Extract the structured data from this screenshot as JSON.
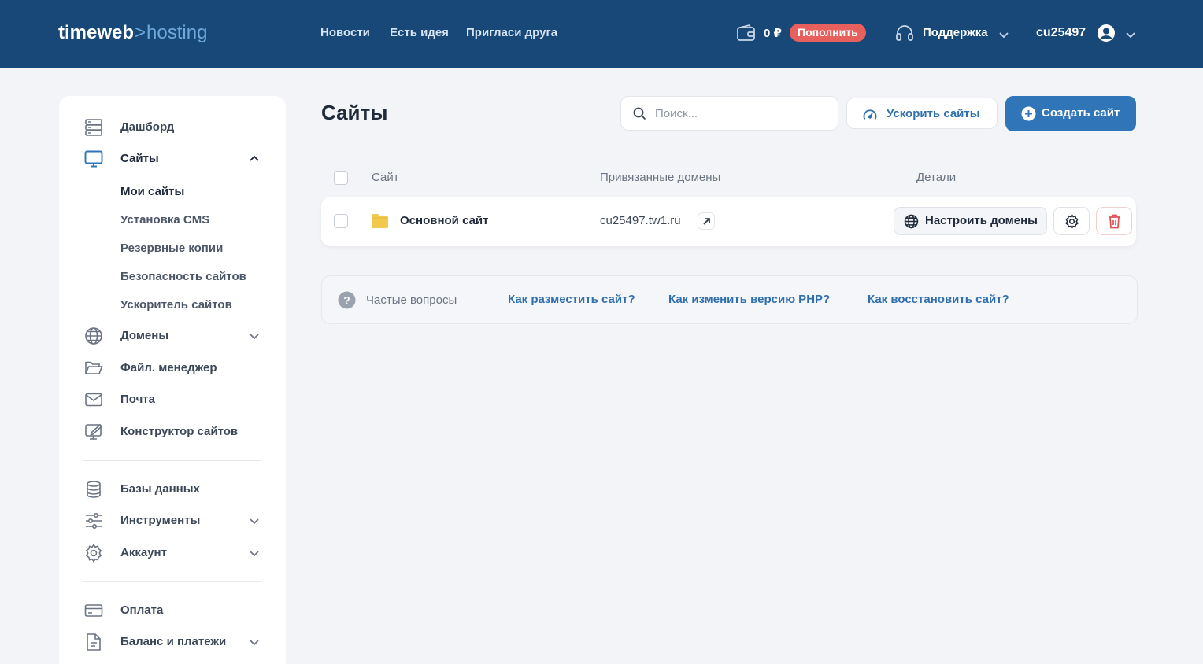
{
  "header": {
    "logo_main": "timeweb",
    "logo_chevron": ">",
    "logo_sub": "hosting",
    "nav": [
      "Новости",
      "Есть идея",
      "Пригласи друга"
    ],
    "balance": "0 ₽",
    "topup_label": "Пополнить",
    "support_label": "Поддержка",
    "username": "cu25497"
  },
  "sidebar": {
    "items": [
      {
        "label": "Дашборд",
        "icon": "dashboard-icon"
      },
      {
        "label": "Сайты",
        "icon": "monitor-icon",
        "expanded": true
      },
      {
        "label": "Домены",
        "icon": "globe-icon"
      },
      {
        "label": "Файл. менеджер",
        "icon": "folder-open-icon"
      },
      {
        "label": "Почта",
        "icon": "mail-icon"
      },
      {
        "label": "Конструктор сайтов",
        "icon": "site-builder-icon"
      },
      {
        "label": "Базы данных",
        "icon": "database-icon"
      },
      {
        "label": "Инструменты",
        "icon": "sliders-icon"
      },
      {
        "label": "Аккаунт",
        "icon": "gear-icon"
      },
      {
        "label": "Оплата",
        "icon": "credit-card-icon"
      },
      {
        "label": "Баланс и платежи",
        "icon": "document-icon"
      }
    ],
    "sites_subitems": [
      "Мои сайты",
      "Установка CMS",
      "Резервные копии",
      "Безопасность сайтов",
      "Ускоритель сайтов"
    ]
  },
  "main": {
    "title": "Сайты",
    "search_placeholder": "Поиск...",
    "speedup_label": "Ускорить сайты",
    "create_label": "Создать сайт",
    "table": {
      "columns": [
        "Сайт",
        "Привязанные домены",
        "Детали"
      ],
      "rows": [
        {
          "site": "Основной сайт",
          "domain": "cu25497.tw1.ru",
          "configure_label": "Настроить домены"
        }
      ]
    },
    "faq": {
      "label": "Частые вопросы",
      "links": [
        "Как разместить сайт?",
        "Как изменить версию PHP?",
        "Как восстановить сайт?"
      ]
    }
  },
  "colors": {
    "header_bg": "#174878",
    "accent_blue": "#2f75b8",
    "link_blue": "#2f6fad",
    "topup_red": "#e8605d",
    "folder_yellow": "#f2c94c",
    "delete_red": "#e05252"
  }
}
